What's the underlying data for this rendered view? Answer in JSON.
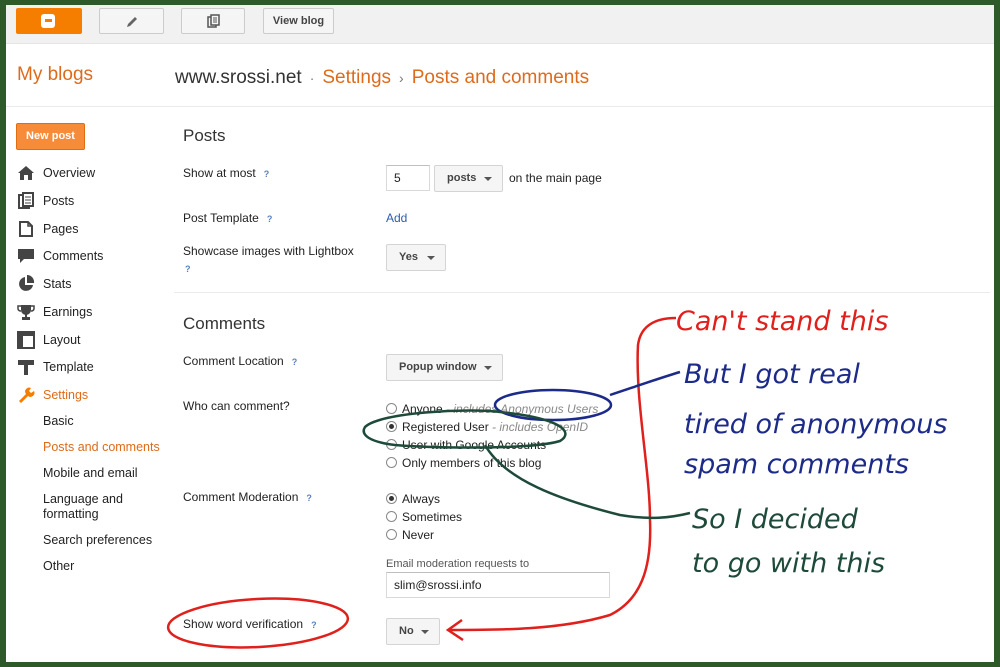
{
  "toolbar": {
    "view_blog_label": "View blog"
  },
  "header": {
    "my_blogs": "My blogs",
    "blog_name": "www.srossi.net",
    "crumb_sep_1": "·",
    "crumb_settings": "Settings",
    "crumb_sep_2": "›",
    "crumb_page": "Posts and comments"
  },
  "sidebar": {
    "new_post_label": "New post",
    "items": [
      {
        "label": "Overview",
        "icon": "home-icon"
      },
      {
        "label": "Posts",
        "icon": "posts-icon"
      },
      {
        "label": "Pages",
        "icon": "pages-icon"
      },
      {
        "label": "Comments",
        "icon": "comments-icon"
      },
      {
        "label": "Stats",
        "icon": "stats-icon"
      },
      {
        "label": "Earnings",
        "icon": "trophy-icon"
      },
      {
        "label": "Layout",
        "icon": "layout-icon"
      },
      {
        "label": "Template",
        "icon": "template-icon"
      },
      {
        "label": "Settings",
        "icon": "wrench-icon"
      }
    ],
    "subitems": [
      {
        "label": "Basic"
      },
      {
        "label": "Posts and comments"
      },
      {
        "label": "Mobile and email"
      },
      {
        "label": "Language and formatting"
      },
      {
        "label": "Search preferences"
      },
      {
        "label": "Other"
      }
    ]
  },
  "posts_section": {
    "title": "Posts",
    "show_at_most_label": "Show at most",
    "help": "?",
    "show_at_most_value": "5",
    "unit_select": "posts",
    "on_main_page": "on the main page",
    "post_template_label": "Post Template",
    "post_template_link": "Add",
    "lightbox_label": "Showcase images with Lightbox",
    "lightbox_value": "Yes"
  },
  "comments_section": {
    "title": "Comments",
    "location_label": "Comment Location",
    "location_value": "Popup window",
    "who_label": "Who can comment?",
    "who_options": [
      {
        "label": "Anyone",
        "note": " - includes Anonymous Users",
        "selected": false
      },
      {
        "label": "Registered User",
        "note": " - includes OpenID",
        "selected": true
      },
      {
        "label": "User with Google Accounts",
        "note": "",
        "selected": false
      },
      {
        "label": "Only members of this blog",
        "note": "",
        "selected": false
      }
    ],
    "moderation_label": "Comment Moderation",
    "moderation_options": [
      {
        "label": "Always",
        "selected": true
      },
      {
        "label": "Sometimes",
        "selected": false
      },
      {
        "label": "Never",
        "selected": false
      }
    ],
    "email_label": "Email moderation requests to",
    "email_value": "slim@srossi.info",
    "word_verification_label": "Show word verification",
    "word_verification_value": "No"
  },
  "annotations": {
    "line1": "Can't stand this",
    "line2": "But I got real",
    "line3": "tired of anonymous",
    "line4": "spam comments",
    "line5": "So I decided",
    "line6": "to go with this",
    "colors": {
      "red": "#e0201c",
      "blue": "#1c2a8a",
      "green": "#1e4a3a"
    }
  }
}
